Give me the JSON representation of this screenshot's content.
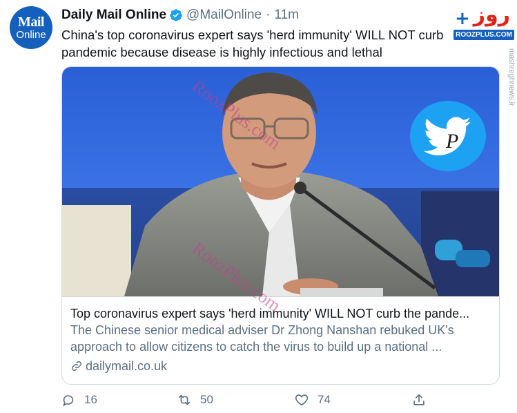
{
  "tweet": {
    "avatar": {
      "line1": "Mail",
      "line2": "Online",
      "color": "#1560bd"
    },
    "author": "Daily Mail Online",
    "handle": "@MailOnline",
    "separator": "·",
    "time": "11m",
    "text": "China's top coronavirus expert says 'herd immunity' WILL NOT curb pandemic because disease is highly infectious and lethal"
  },
  "card": {
    "title": "Top coronavirus expert says 'herd immunity' WILL NOT curb the pande...",
    "description": "The Chinese senior medical adviser Dr Zhong Nanshan rebuked UK's approach to allow citizens to catch the virus to build up a national ...",
    "domain": "dailymail.co.uk"
  },
  "actions": {
    "replies": "16",
    "retweets": "50",
    "likes": "74"
  },
  "watermark": {
    "text_top": "RoozPlus.com",
    "text_bottom": "RoozPlus.com",
    "logo_fa": "روز",
    "logo_plus": "+",
    "logo_en": "ROOZPLUS.COM",
    "side_text": "mashreghnews.ir"
  },
  "colors": {
    "accent": "#1da1f2",
    "muted": "#5b7083",
    "border": "#cfd9de",
    "brand": "#e2231a"
  }
}
